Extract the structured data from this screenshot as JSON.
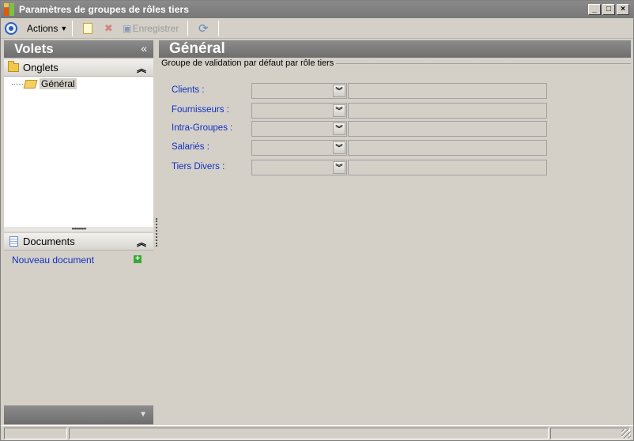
{
  "window": {
    "title": "Paramètres de groupes de rôles tiers",
    "buttons": {
      "minimize": "_",
      "maximize": "□",
      "close": "×"
    }
  },
  "toolbar": {
    "actions_label": "Actions",
    "save_label": "Enregistrer"
  },
  "left_panel": {
    "title": "Volets",
    "collapse_glyph": "«",
    "onglets": {
      "title": "Onglets",
      "items": [
        {
          "label": "Général"
        }
      ]
    },
    "documents": {
      "title": "Documents",
      "new_document_label": "Nouveau document"
    }
  },
  "main": {
    "title": "Général",
    "group_title": "Groupe de validation par défaut par rôle tiers",
    "rows": [
      {
        "label": "Clients  :",
        "combo_value": "",
        "field_value": ""
      },
      {
        "label": "Fournisseurs :",
        "combo_value": "",
        "field_value": ""
      },
      {
        "label": "Intra-Groupes :",
        "combo_value": "",
        "field_value": ""
      },
      {
        "label": "Salariés :",
        "combo_value": "",
        "field_value": ""
      },
      {
        "label": "Tiers Divers :",
        "combo_value": "",
        "field_value": ""
      }
    ]
  },
  "colors": {
    "label_blue": "#1030c0",
    "header_gray": "#7a7a7a",
    "background": "#d4d0c8"
  },
  "icons": {
    "app": "app-logo-icon",
    "nav": "nav-circle-icon",
    "new": "new-document-icon",
    "delete": "delete-icon",
    "save": "save-icon",
    "refresh": "refresh-icon"
  }
}
